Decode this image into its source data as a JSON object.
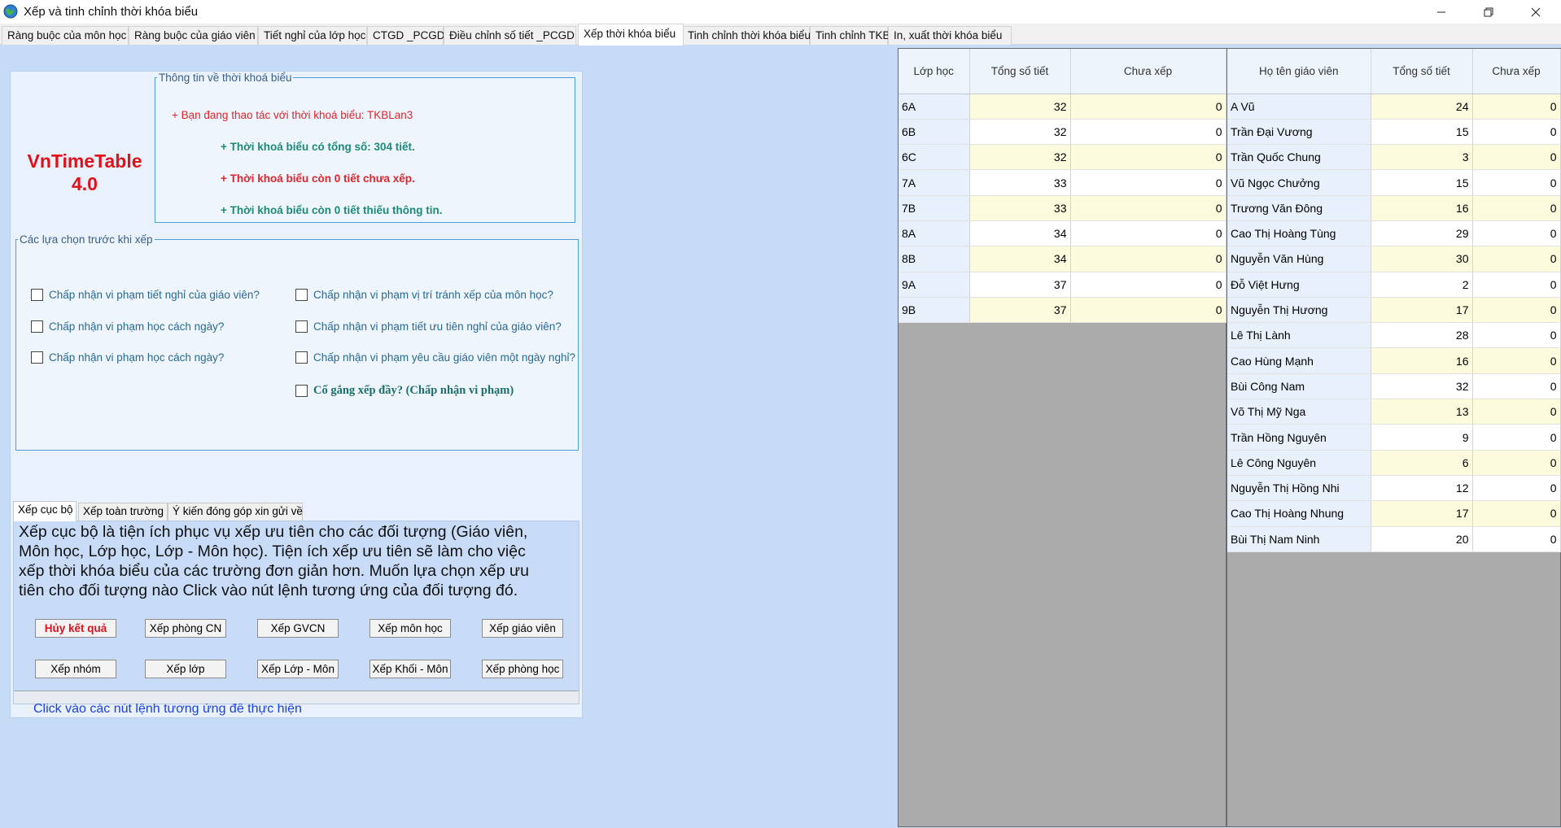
{
  "window": {
    "title": "Xếp và tinh chỉnh thời khóa biểu",
    "minimize": "—",
    "maximize": "❐",
    "close": "✕"
  },
  "tabs": [
    {
      "label": "Ràng buộc của môn học"
    },
    {
      "label": "Ràng buộc của giáo viên"
    },
    {
      "label": "Tiết nghỉ của lớp học"
    },
    {
      "label": "CTGD _PCGD"
    },
    {
      "label": "Điều chỉnh số tiết _PCGD"
    },
    {
      "label": "Xếp thời khóa biểu",
      "active": true
    },
    {
      "label": "Tinh chỉnh thời khóa biểu"
    },
    {
      "label": "Tinh chỉnh TKB"
    },
    {
      "label": "In, xuất thời khóa biểu"
    }
  ],
  "logo": {
    "line1": "VnTimeTable",
    "line2": "4.0"
  },
  "info": {
    "legend": "Thông tin về thời khoá biểu",
    "line1": "+ Bạn đang thao tác với thời khoá biểu: TKBLan3",
    "line2": "+ Thời khoá biểu có tổng số: 304 tiết.",
    "line3": "+ Thời khoá biểu còn 0 tiết chưa xếp.",
    "line4": "+ Thời khoá biểu còn 0 tiết thiếu thông tin."
  },
  "options": {
    "legend": "Các lựa chọn trước khi xếp",
    "opt1": "Chấp nhận vi phạm tiết nghỉ của giáo viên?",
    "opt2": "Chấp nhận vi phạm học cách ngày?",
    "opt3": "Chấp nhận vi phạm học cách ngày?",
    "opt4": "Chấp nhận vi phạm vị trí tránh xếp của môn học?",
    "opt5": "Chấp nhận vi phạm tiết ưu tiên nghỉ của giáo viên?",
    "opt6": "Chấp nhận vi phạm yêu cầu giáo viên một ngày nghỉ?",
    "opt7": "Cố gắng xếp đầy? (Chấp nhận vi phạm)"
  },
  "subtabs": {
    "tab1": "Xếp cục bộ",
    "tab2": "Xếp toàn trường",
    "tab3": "Ý kiến đóng góp xin gửi về"
  },
  "local": {
    "description": "Xếp cục bộ là tiện ích phục vụ xếp ưu tiên cho các đối tượng (Giáo viên, Môn học, Lớp học, Lớp - Môn học). Tiện ích xếp ưu tiên sẽ làm cho việc xếp thời khóa biểu của các trường đơn giản hơn. Muốn lựa chọn xếp ưu tiên cho đối tượng nào Click vào nút lệnh tương ứng của đối tượng đó.",
    "buttons": {
      "cancel": "Hủy kết quả",
      "room_cn": "Xếp phòng CN",
      "gvcn": "Xếp GVCN",
      "subject": "Xếp môn học",
      "teacher": "Xếp giáo viên",
      "group": "Xếp nhóm",
      "class": "Xếp lớp",
      "class_subject": "Xếp Lớp - Môn",
      "grade_subject": "Xếp Khối - Môn",
      "room": "Xếp phòng học"
    },
    "hint": "Click vào các nút lệnh tương ứng để thực hiện"
  },
  "class_table": {
    "headers": [
      "Lớp học",
      "Tổng số tiết",
      "Chưa xếp"
    ],
    "rows": [
      [
        "6A",
        "32",
        "0"
      ],
      [
        "6B",
        "32",
        "0"
      ],
      [
        "6C",
        "32",
        "0"
      ],
      [
        "7A",
        "33",
        "0"
      ],
      [
        "7B",
        "33",
        "0"
      ],
      [
        "8A",
        "34",
        "0"
      ],
      [
        "8B",
        "34",
        "0"
      ],
      [
        "9A",
        "37",
        "0"
      ],
      [
        "9B",
        "37",
        "0"
      ]
    ]
  },
  "teacher_table": {
    "headers": [
      "Họ tên giáo viên",
      "Tổng số tiết",
      "Chưa xếp"
    ],
    "rows": [
      [
        "A Vũ",
        "24",
        "0"
      ],
      [
        "Trần Đại Vương",
        "15",
        "0"
      ],
      [
        "Trần Quốc Chung",
        "3",
        "0"
      ],
      [
        "Vũ Ngọc Chưởng",
        "15",
        "0"
      ],
      [
        "Trương Văn Đông",
        "16",
        "0"
      ],
      [
        "Cao Thị Hoàng Tùng",
        "29",
        "0"
      ],
      [
        "Nguyễn Văn Hùng",
        "30",
        "0"
      ],
      [
        "Đỗ Việt Hưng",
        "2",
        "0"
      ],
      [
        "Nguyễn Thị Hương",
        "17",
        "0"
      ],
      [
        "Lê Thị Lành",
        "28",
        "0"
      ],
      [
        "Cao Hùng Mạnh",
        "16",
        "0"
      ],
      [
        "Bùi Công Nam",
        "32",
        "0"
      ],
      [
        "Võ Thị Mỹ Nga",
        "13",
        "0"
      ],
      [
        "Trần Hồng Nguyên",
        "9",
        "0"
      ],
      [
        "Lê Công Nguyên",
        "6",
        "0"
      ],
      [
        "Nguyễn Thị Hồng Nhi",
        "12",
        "0"
      ],
      [
        "Cao Thị Hoàng Nhung",
        "17",
        "0"
      ],
      [
        "Bùi Thị Nam Ninh",
        "20",
        "0"
      ]
    ]
  }
}
